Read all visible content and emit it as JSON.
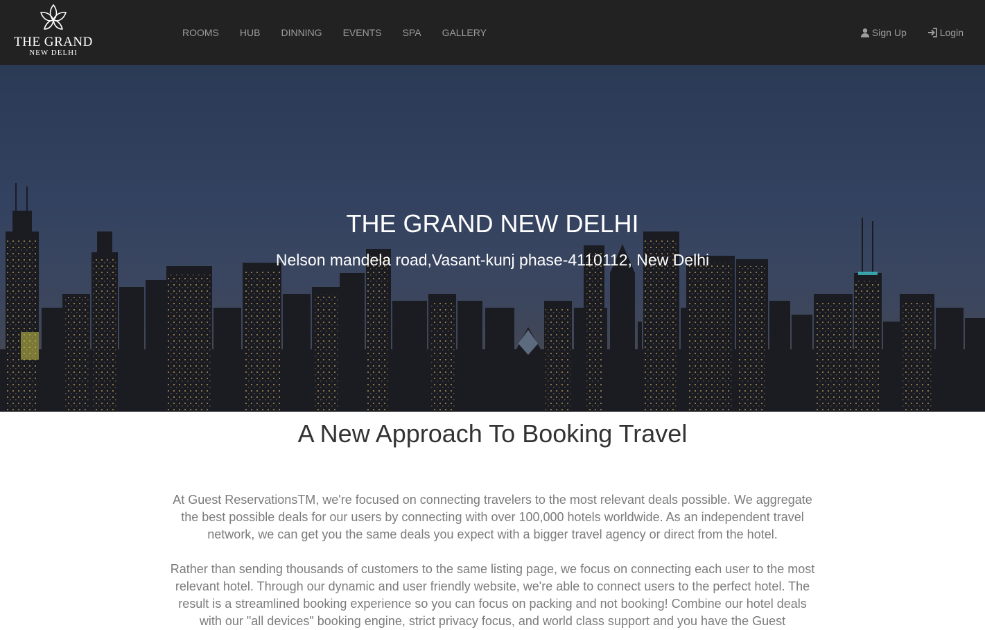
{
  "brand": {
    "line1": "THE GRAND",
    "line2": "NEW DELHI",
    "logo_icon": "lotus-icon"
  },
  "nav": {
    "items": [
      {
        "label": "ROOMS"
      },
      {
        "label": "HUB"
      },
      {
        "label": "DINNING"
      },
      {
        "label": "EVENTS"
      },
      {
        "label": "SPA"
      },
      {
        "label": "GALLERY"
      }
    ],
    "signup": {
      "label": "Sign Up",
      "icon": "user-icon"
    },
    "login": {
      "label": "Login",
      "icon": "login-icon"
    }
  },
  "hero": {
    "title": "THE GRAND NEW DELHI",
    "address": "Nelson mandela road,Vasant-kunj phase-4110112, New Delhi",
    "background": "city-skyline-at-night"
  },
  "content": {
    "title": "A New Approach To Booking Travel",
    "paragraph1": "At Guest ReservationsTM, we're focused on connecting travelers to the most relevant deals possible. We aggregate the best possible deals for our users by connecting with over 100,000 hotels worldwide. As an independent travel network, we can get you the same deals you expect with a bigger travel agency or direct from the hotel.",
    "paragraph2": "Rather than sending thousands of customers to the same listing page, we focus on connecting each user to the most relevant hotel. Through our dynamic and user friendly website, we're able to connect users to the perfect hotel. The result is a streamlined booking experience so you can focus on packing and not booking! Combine our hotel deals with our \"all devices\" booking engine, strict privacy focus, and world class support and you have the Guest"
  },
  "colors": {
    "navbar_bg": "#222222",
    "nav_text": "#9d9d9d",
    "hero_text": "#ffffff",
    "heading_text": "#333333",
    "body_text": "#7b7b7b"
  }
}
